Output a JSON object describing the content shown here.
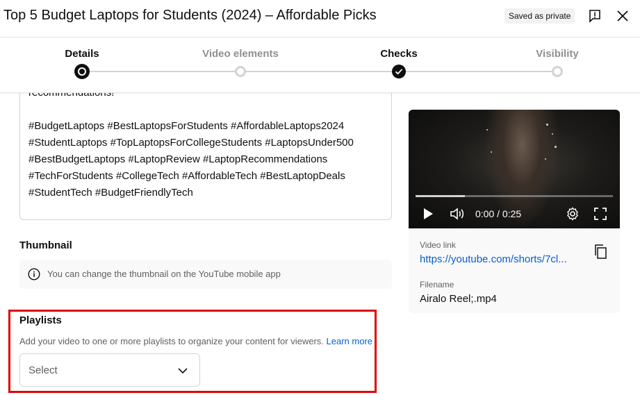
{
  "header": {
    "title": "Top 5 Budget Laptops for Students (2024) – Affordable Picks",
    "saved_badge": "Saved as private",
    "feedback_icon": "feedback-icon",
    "close_icon": "close-icon"
  },
  "stepper": {
    "steps": [
      {
        "label": "Details",
        "state": "current"
      },
      {
        "label": "Video elements",
        "state": "upcoming"
      },
      {
        "label": "Checks",
        "state": "done"
      },
      {
        "label": "Visibility",
        "state": "upcoming"
      }
    ]
  },
  "description": {
    "text": "recommendations!\n\n#BudgetLaptops #BestLaptopsForStudents #AffordableLaptops2024\n#StudentLaptops #TopLaptopsForCollegeStudents #LaptopsUnder500\n#BestBudgetLaptops #LaptopReview #LaptopRecommendations\n#TechForStudents #CollegeTech #AffordableTech #BestLaptopDeals\n#StudentTech #BudgetFriendlyTech"
  },
  "thumbnail": {
    "title": "Thumbnail",
    "info": "You can change the thumbnail on the YouTube mobile app",
    "info_icon": "info-icon"
  },
  "playlists": {
    "title": "Playlists",
    "description": "Add your video to one or more playlists to organize your content for viewers.",
    "learn_more": "Learn more",
    "select_label": "Select",
    "highlight_color": "#e00000"
  },
  "video": {
    "time": "0:00 / 0:25",
    "progress": 0.25,
    "video_link_label": "Video link",
    "video_link": "https://youtube.com/shorts/7cl...",
    "filename_label": "Filename",
    "filename": "Airalo Reel;.mp4"
  },
  "colors": {
    "accent_link": "#065fd4",
    "text_primary": "#0f0f0f",
    "text_secondary": "#606060"
  }
}
